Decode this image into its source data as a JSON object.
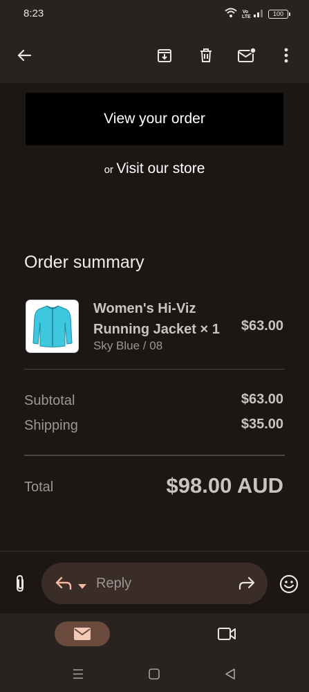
{
  "status_bar": {
    "time": "8:23",
    "battery": "100",
    "icons": [
      "wifi-icon",
      "volte-icon",
      "signal-icon",
      "battery-icon"
    ],
    "volte_text": "Vo LTE"
  },
  "toolbar": {
    "icons": [
      "back-arrow-icon",
      "archive-icon",
      "delete-icon",
      "mark-unread-icon",
      "more-options-icon"
    ]
  },
  "email": {
    "view_order_label": "View your order",
    "or_text": "or",
    "visit_store_label": "Visit our store",
    "summary_title": "Order summary",
    "product": {
      "name_line1": "Women's Hi-Viz",
      "name_line2": "Running Jacket × 1",
      "variant": "Sky Blue / 08",
      "price": "$63.00",
      "image": "sky-blue-jacket"
    },
    "subtotal_label": "Subtotal",
    "subtotal_value": "$63.00",
    "shipping_label": "Shipping",
    "shipping_value": "$35.00",
    "total_label": "Total",
    "total_value": "$98.00 AUD"
  },
  "reply_bar": {
    "placeholder": "Reply",
    "icons": [
      "attach-icon",
      "reply-icon",
      "chevron-down-icon",
      "forward-icon",
      "emoji-icon"
    ]
  },
  "bottom_nav": {
    "items": [
      "mail-icon",
      "meet-video-icon"
    ],
    "active": "mail"
  },
  "system_nav": {
    "items": [
      "recents-icon",
      "home-icon",
      "back-icon"
    ]
  },
  "colors": {
    "background": "#1c1615",
    "bar": "#282321",
    "reply_pill": "#3a2c26",
    "active_nav": "#6a4a3c",
    "accent": "#f4b8a0",
    "jacket": "#3ec8e0"
  }
}
